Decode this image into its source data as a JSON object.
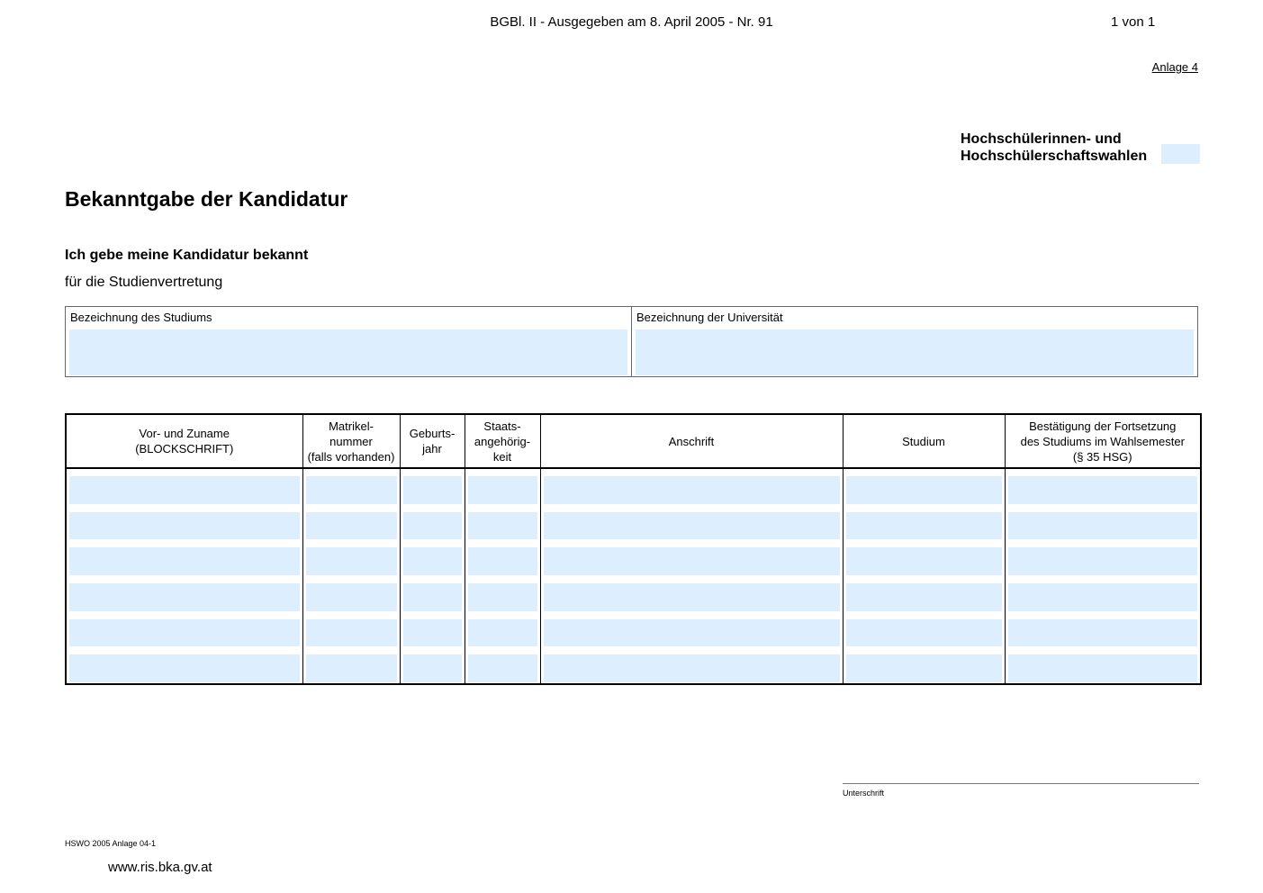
{
  "header": {
    "gazette": "BGBl. II - Ausgegeben am 8. April 2005 - Nr. 91",
    "page": "1 von 1",
    "annex": "Anlage 4"
  },
  "election_label": [
    "Hochschülerinnen- und",
    "Hochschülerschaftswahlen"
  ],
  "title": "Bekanntgabe der Kandidatur",
  "subtitle": "Ich gebe meine Kandidatur bekannt",
  "subtitle2": "für die Studienvertretung",
  "fields": {
    "study_label": "Bezeichnung des Studiums",
    "university_label": "Bezeichnung der Universität"
  },
  "table": {
    "columns": [
      [
        "Vor- und Zuname",
        "(BLOCKSCHRIFT)"
      ],
      [
        "Matrikel-",
        "nummer",
        "(falls vorhanden)"
      ],
      [
        "Geburts-",
        "jahr"
      ],
      [
        "Staats-",
        "angehörig-",
        "keit"
      ],
      [
        "Anschrift"
      ],
      [
        "Studium"
      ],
      [
        "Bestätigung der Fortsetzung",
        "des Studiums im Wahlsemester",
        "(§ 35 HSG)"
      ]
    ],
    "row_count": 6
  },
  "signature_label": "Unterschrift",
  "footer": {
    "code": "HSWO 2005 Anlage 04-1",
    "url": "www.ris.bka.gv.at"
  },
  "colors": {
    "field_fill": "#ddeeff"
  }
}
